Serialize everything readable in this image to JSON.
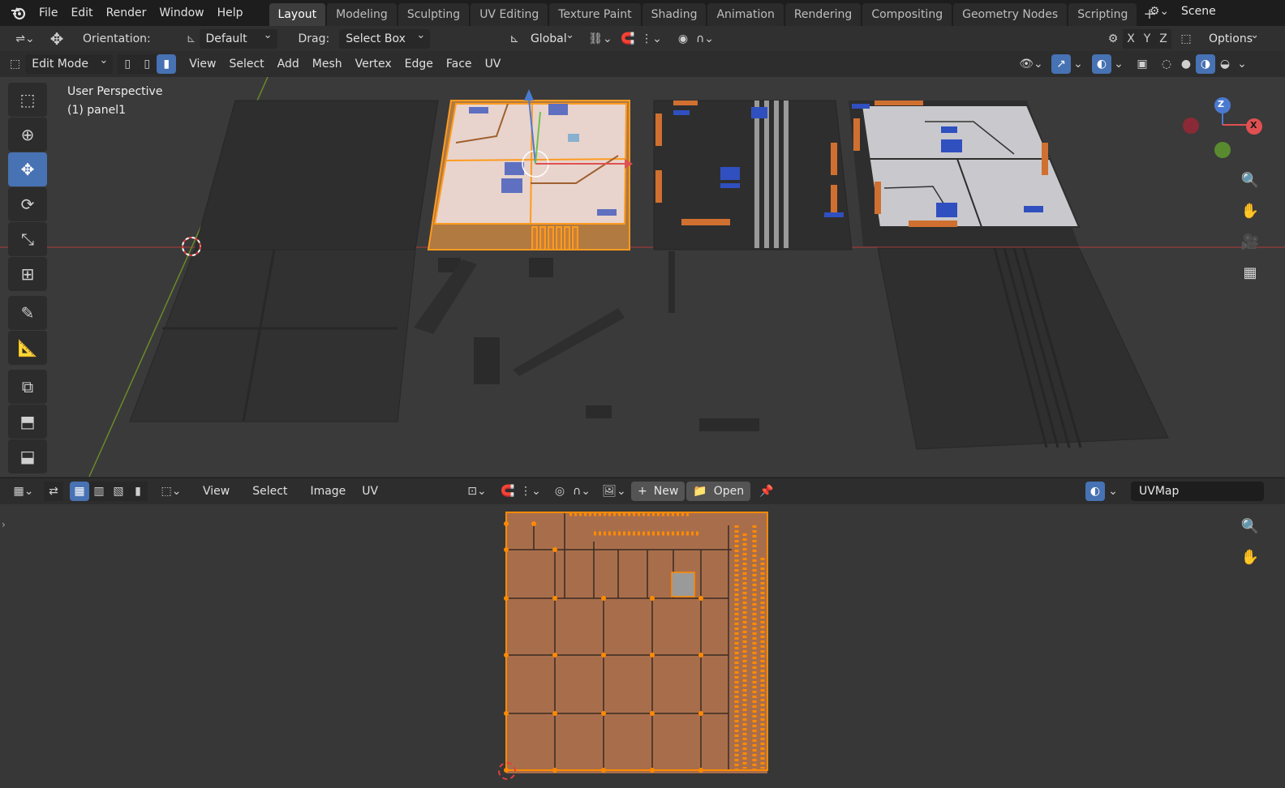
{
  "menubar": {
    "items": [
      "File",
      "Edit",
      "Render",
      "Window",
      "Help"
    ],
    "workspaces": [
      "Layout",
      "Modeling",
      "Sculpting",
      "UV Editing",
      "Texture Paint",
      "Shading",
      "Animation",
      "Rendering",
      "Compositing",
      "Geometry Nodes",
      "Scripting"
    ],
    "active_workspace": "Layout",
    "scene": "Scene"
  },
  "tool_settings": {
    "orientation_label": "Orientation:",
    "orientation_value": "Default",
    "drag_label": "Drag:",
    "drag_value": "Select Box",
    "transform_orientation": "Global",
    "axis_x": "X",
    "axis_y": "Y",
    "axis_z": "Z",
    "options": "Options"
  },
  "viewport_header": {
    "mode": "Edit Mode",
    "menus": [
      "View",
      "Select",
      "Add",
      "Mesh",
      "Vertex",
      "Edge",
      "Face",
      "UV"
    ]
  },
  "viewport": {
    "perspective": "User Perspective",
    "object": "(1) panel1",
    "gizmo": {
      "z": "Z",
      "x": "X"
    }
  },
  "uv_editor": {
    "menus": [
      "View",
      "Select",
      "Image",
      "UV"
    ],
    "new_label": "New",
    "open_label": "Open",
    "uvmap": "UVMap"
  },
  "colors": {
    "accent": "#4772b3",
    "selection": "#ff8a00",
    "background": "#303030"
  }
}
